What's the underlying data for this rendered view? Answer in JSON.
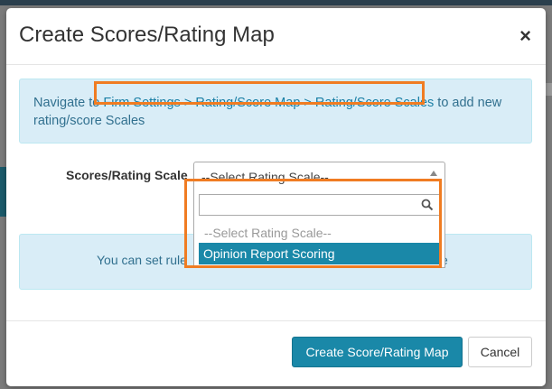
{
  "modal": {
    "title": "Create Scores/Rating Map",
    "close_glyph": "×"
  },
  "info": {
    "prefix": "Navigate to ",
    "link": "Firm Settings > Rating/Score Map > Rating/Score Scales",
    "suffix": " to add new rating/score Scales"
  },
  "form": {
    "label": "Scores/Rating Scale",
    "select_value": "--Select Rating Scale--",
    "search_value": "",
    "options": [
      "--Select Rating Scale--",
      "Opinion Report Scoring"
    ],
    "highlighted_option": "Opinion Report Scoring"
  },
  "info2": {
    "text_start": "You can set rule",
    "text_end": "e"
  },
  "footer": {
    "primary_label": "Create Score/Rating Map",
    "cancel_label": "Cancel"
  },
  "colors": {
    "accent": "#1a88a8",
    "highlight": "#f07c22",
    "info_bg": "#d9edf7",
    "info_text": "#31708f"
  },
  "icons": {
    "close": "close-icon",
    "search": "search-icon",
    "dropdown": "chevron-up-icon"
  }
}
